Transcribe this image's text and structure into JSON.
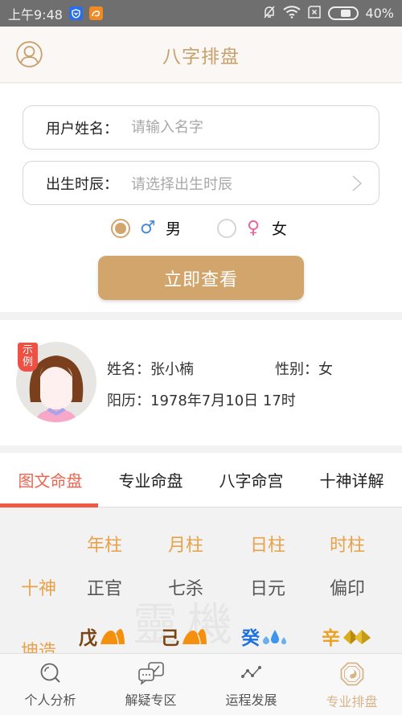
{
  "status_bar": {
    "time": "上午9:48",
    "battery": "40%"
  },
  "header": {
    "title": "八字排盘"
  },
  "form": {
    "name_label": "用户姓名：",
    "name_placeholder": "请输入名字",
    "birth_label": "出生时辰：",
    "birth_placeholder": "请选择出生时辰",
    "gender_options": [
      {
        "symbol": "♂",
        "label": "男",
        "checked": true,
        "color": "#4a8ad4"
      },
      {
        "symbol": "♀",
        "label": "女",
        "checked": false,
        "color": "#e8649a"
      }
    ],
    "submit_label": "立即查看"
  },
  "example": {
    "tag": "示例",
    "name": "姓名：张小楠",
    "gender": "性别：女",
    "birth": "阳历：1978年7月10日 17时"
  },
  "tabs": [
    {
      "label": "图文命盘",
      "active": true
    },
    {
      "label": "专业命盘",
      "active": false
    },
    {
      "label": "八字命宫",
      "active": false
    },
    {
      "label": "十神详解",
      "active": false
    }
  ],
  "chart_grid": {
    "pillars": [
      "年柱",
      "月柱",
      "日柱",
      "时柱"
    ],
    "rows": [
      {
        "label": "十神",
        "values": [
          "正官",
          "七杀",
          "日元",
          "偏印"
        ]
      },
      {
        "label": "坤造",
        "values": [
          "戊",
          "己",
          "癸",
          "辛"
        ]
      }
    ],
    "stem_elements": [
      {
        "stem": "戊",
        "element": "earth",
        "color": "#7a4512"
      },
      {
        "stem": "己",
        "element": "earth",
        "color": "#7a4512"
      },
      {
        "stem": "癸",
        "element": "water",
        "color": "#1e6fe0"
      },
      {
        "stem": "辛",
        "element": "metal",
        "color": "#f0a020"
      }
    ],
    "watermark": "靈機"
  },
  "bottom_nav": [
    {
      "label": "个人分析",
      "icon": "search-icon",
      "active": false
    },
    {
      "label": "解疑专区",
      "icon": "chat-icon",
      "active": false
    },
    {
      "label": "运程发展",
      "icon": "trend-icon",
      "active": false
    },
    {
      "label": "专业排盘",
      "icon": "bagua-icon",
      "active": true
    }
  ],
  "colors": {
    "accent": "#d2a56c",
    "tab_active": "#f05a45",
    "pillar_header": "#e8a24a"
  }
}
